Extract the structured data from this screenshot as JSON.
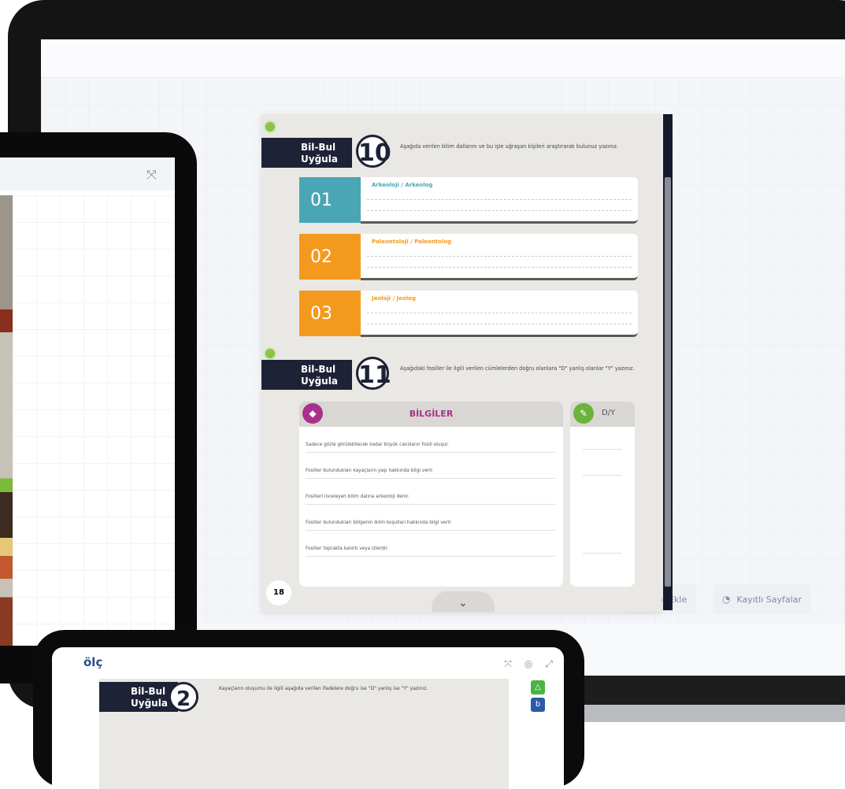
{
  "monitor": {
    "buttons": [
      {
        "icon": "note-icon",
        "glyph": "▣",
        "label": "Not Ekle"
      },
      {
        "icon": "save-icon",
        "glyph": "◔",
        "label": "Kayıtlı Sayfalar"
      }
    ]
  },
  "page": {
    "number": "18",
    "activity10": {
      "title_line1": "Bil-Bul",
      "title_line2": "Uyğula",
      "number": "10",
      "instruction": "Aşağıda verilen bilim dallarını ve bu işle uğraşan kişileri araştırarak bulunuz yazınız.",
      "rows": [
        {
          "badge": "01",
          "title": "Arkeoloji / Arkeolog",
          "color": "#4aa6b4"
        },
        {
          "badge": "02",
          "title": "Paleontoloji / Paleontolog",
          "color": "#f39a1e"
        },
        {
          "badge": "03",
          "title": "Jeoloji / Jeolog",
          "color": "#f39a1e"
        }
      ]
    },
    "activity11": {
      "title_line1": "Bil-Bul",
      "title_line2": "Uyğula",
      "number": "11",
      "instruction": "Aşağıdaki fosiller ile ilgili verilen cümlelerden doğru olanlara \"D\" yanlış olanlar \"Y\" yazınız.",
      "table_title": "BİLGİLER",
      "answer_title": "D/Y",
      "facts": [
        "Sadece gözle görülebilecek kadar büyük canlıların fosili oluşur.",
        "Fosiller bulundukları kayaçların yaşı hakkında bilgi verir.",
        "Fosilleri inceleyen bilim dalına arkeoloji denir.",
        "Fosiller bulundukları bölgenin iklim koşulları hakkında bilgi verir.",
        "Fosiller toprakta kalıntı veya izlerdir."
      ]
    },
    "chevron": "⌄"
  },
  "tablet": {
    "expand_icon": "⤧"
  },
  "phone": {
    "logo": "ölç",
    "title_line1": "Bil-Bul",
    "title_line2": "Uyğula",
    "number": "2",
    "instruction": "Kayaçların oluşumu ile ilgili aşağıda verilen ifadelere doğru ise \"D\" yanlış ise \"Y\" yazınız.",
    "icons": [
      "⤧",
      "◎",
      "⤢"
    ],
    "side": [
      "△",
      "b"
    ]
  },
  "colors": {
    "navy": "#1e2236",
    "purple": "#a9308c",
    "green": "#6bb33a",
    "teal": "#4aa6b4",
    "orange": "#f39a1e"
  }
}
